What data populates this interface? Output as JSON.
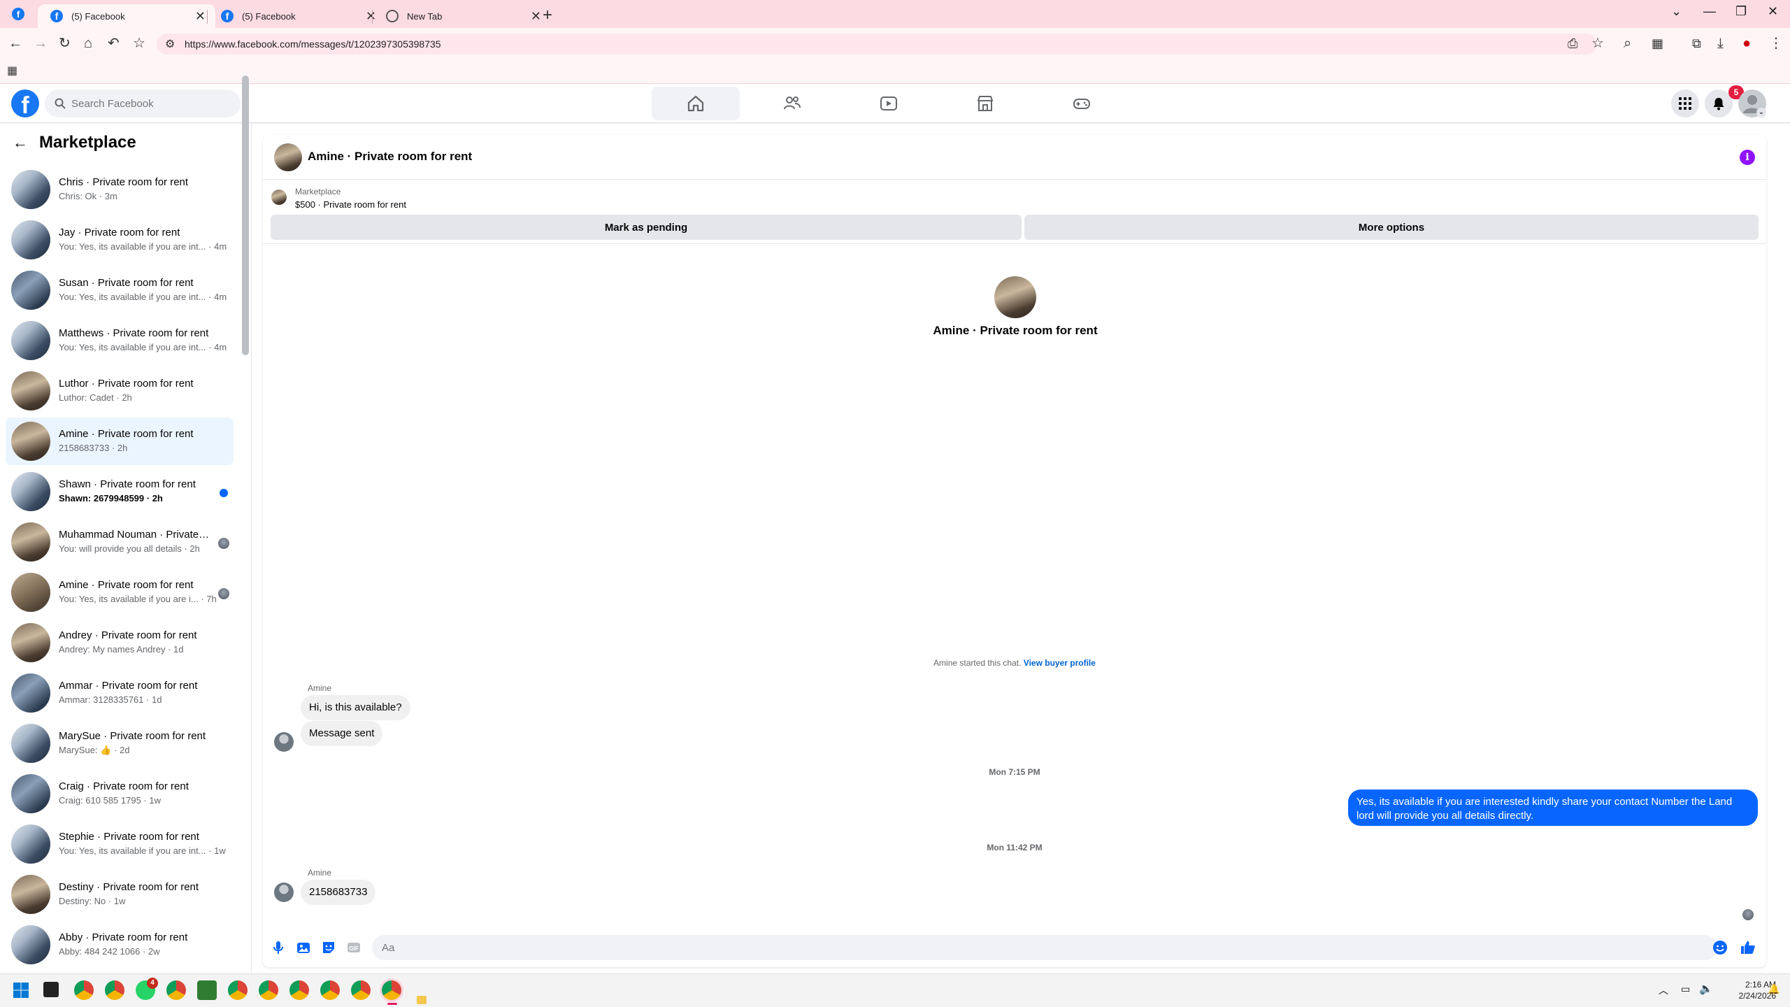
{
  "browser": {
    "tabs": [
      {
        "title": "(5) Facebook",
        "icon": "facebook-icon",
        "active": true
      },
      {
        "title": "(5) Facebook",
        "icon": "facebook-icon",
        "active": false
      },
      {
        "title": "New Tab",
        "icon": "globe-icon",
        "active": false
      }
    ],
    "url": "https://www.facebook.com/messages/t/1202397305398735"
  },
  "fb": {
    "logo": "f",
    "search_placeholder": "Search Facebook",
    "notification_count": "5",
    "nav": [
      "home-icon",
      "friends-icon",
      "watch-icon",
      "marketplace-icon",
      "gaming-icon"
    ]
  },
  "sidebar": {
    "title": "Marketplace",
    "conversations": [
      {
        "name": "Chris · Private room for rent",
        "preview": "Chris: Ok · 3m",
        "thumb": "th1"
      },
      {
        "name": "Jay · Private room for rent",
        "preview": "You: Yes, its available if you are int... · 4m",
        "thumb": "th1"
      },
      {
        "name": "Susan · Private room for rent",
        "preview": "You: Yes, its available if you are int... · 4m",
        "thumb": "th3"
      },
      {
        "name": "Matthews · Private room for rent",
        "preview": "You: Yes, its available if you are int... · 4m",
        "thumb": "th1"
      },
      {
        "name": "Luthor · Private room for rent",
        "preview": "Luthor: Cadet · 2h",
        "thumb": "th2"
      },
      {
        "name": "Amine · Private room for rent",
        "preview": "2158683733 · 2h",
        "thumb": "th2",
        "selected": true
      },
      {
        "name": "Shawn · Private room for rent",
        "preview": "Shawn: 2679948599 · 2h",
        "thumb": "th1",
        "unread": true
      },
      {
        "name": "Muhammad Nouman · Private room for rent",
        "preview": "You: will provide you all details · 2h",
        "thumb": "th2",
        "seen": true
      },
      {
        "name": "Amine · Private room for rent",
        "preview": "You: Yes, its available if you are i... · 7h",
        "thumb": "th4",
        "seen": true
      },
      {
        "name": "Andrey · Private room for rent",
        "preview": "Andrey: My names Andrey · 1d",
        "thumb": "th2"
      },
      {
        "name": "Ammar · Private room for rent",
        "preview": "Ammar: 3128335761 · 1d",
        "thumb": "th3"
      },
      {
        "name": "MarySue · Private room for rent",
        "preview": "MarySue: 👍 · 2d",
        "thumb": "th1"
      },
      {
        "name": "Craig · Private room for rent",
        "preview": "Craig: 610 585 1795 · 1w",
        "thumb": "th3"
      },
      {
        "name": "Stephie · Private room for rent",
        "preview": "You: Yes, its available if you are int... · 1w",
        "thumb": "th1"
      },
      {
        "name": "Destiny · Private room for rent",
        "preview": "Destiny: No · 1w",
        "thumb": "th2"
      },
      {
        "name": "Abby · Private room for rent",
        "preview": "Abby: 484 242 1066 · 2w",
        "thumb": "th1"
      }
    ]
  },
  "chat": {
    "title": "Amine · Private room for rent",
    "listing": {
      "source": "Marketplace",
      "title": "$500 · Private room for rent",
      "mark_pending": "Mark as pending",
      "more_options": "More options"
    },
    "hero_title": "Amine · Private room for rent",
    "started_text": "Amine started this chat.",
    "buyer_profile_link": "View buyer profile",
    "sender1": "Amine",
    "msg1": "Hi, is this available?",
    "msg2": "Message sent",
    "time1": "Mon 7:15 PM",
    "msg_out": "Yes, its available if you are interested kindly share your contact Number the Land lord will provide you all details directly.",
    "time2": "Mon 11:42 PM",
    "sender2": "Amine",
    "msg3": "2158683733",
    "composer_placeholder": "Aa"
  },
  "taskbar": {
    "time": "2:16 AM",
    "date": "2/24/2026",
    "whatsapp_badge": "4"
  },
  "colors": {
    "fb_blue": "#1877f2",
    "message_blue": "#0866ff",
    "tab_strip": "#fcdbe3",
    "info_purple": "#9013fe",
    "badge_red": "#e41e3f"
  }
}
